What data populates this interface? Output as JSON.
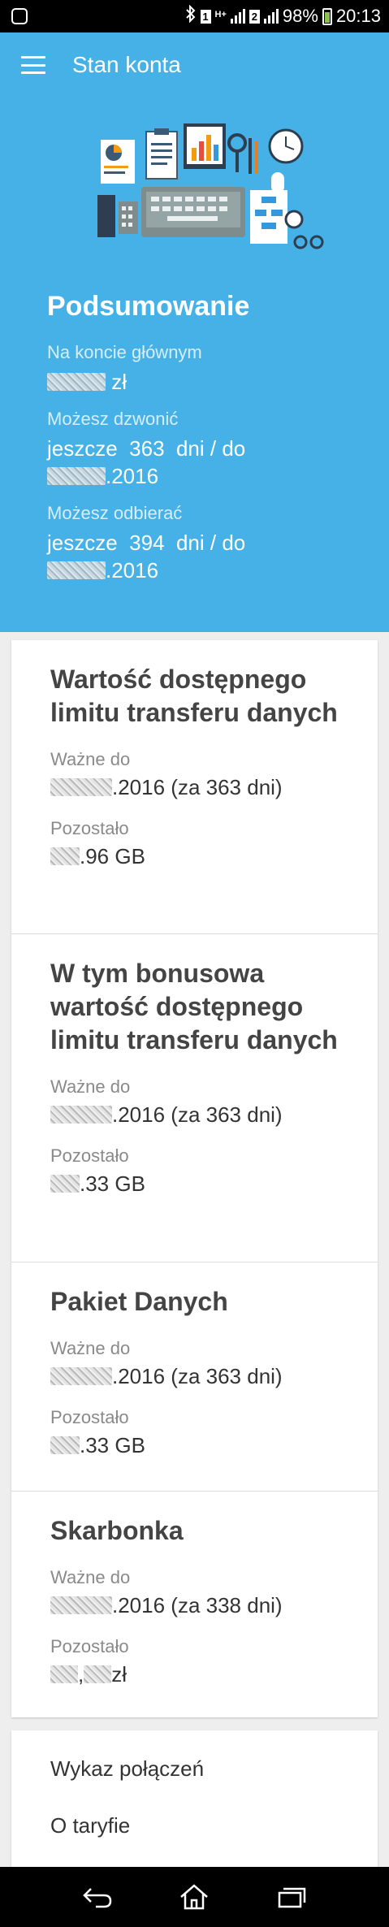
{
  "status_bar": {
    "sim1": "1",
    "net_type": "H+",
    "sim2": "2",
    "battery": "98%",
    "time": "20:13"
  },
  "header": {
    "title": "Stan konta"
  },
  "summary": {
    "title": "Podsumowanie",
    "main_account_label": "Na koncie głównym",
    "main_account_currency": "zł",
    "call_label": "Możesz dzwonić",
    "call_line1": "jeszcze  363  dni / do",
    "call_date_suffix": ".2016",
    "receive_label": "Możesz odbierać",
    "receive_line1": "jeszcze  394  dni / do",
    "receive_date_suffix": ".2016"
  },
  "sections": [
    {
      "title": "Wartość dostępnego limitu transferu danych",
      "valid_label": "Ważne do",
      "valid_suffix": ".2016 (za 363 dni)",
      "remaining_label": "Pozostało",
      "remaining_suffix": ".96 GB"
    },
    {
      "title": "W tym bonusowa wartość dostępnego limitu transferu danych",
      "valid_label": "Ważne do",
      "valid_suffix": ".2016 (za 363 dni)",
      "remaining_label": "Pozostało",
      "remaining_suffix": ".33 GB"
    },
    {
      "title": "Pakiet Danych",
      "valid_label": "Ważne do",
      "valid_suffix": ".2016 (za 363 dni)",
      "remaining_label": "Pozostało",
      "remaining_suffix": ".33 GB"
    },
    {
      "title": "Skarbonka",
      "valid_label": "Ważne do",
      "valid_suffix": ".2016 (za 338 dni)",
      "remaining_label": "Pozostało",
      "remaining_sep": ",",
      "remaining_suffix": "zł"
    }
  ],
  "links": {
    "calls_list": "Wykaz połączeń",
    "tariff": "O taryfie"
  },
  "icons": {
    "menu": "hamburger-menu-icon",
    "back": "back-icon",
    "home": "home-icon",
    "recents": "recent-apps-icon"
  },
  "colors": {
    "header_bg": "#45b1e6",
    "accent_text": "#ffffff"
  }
}
